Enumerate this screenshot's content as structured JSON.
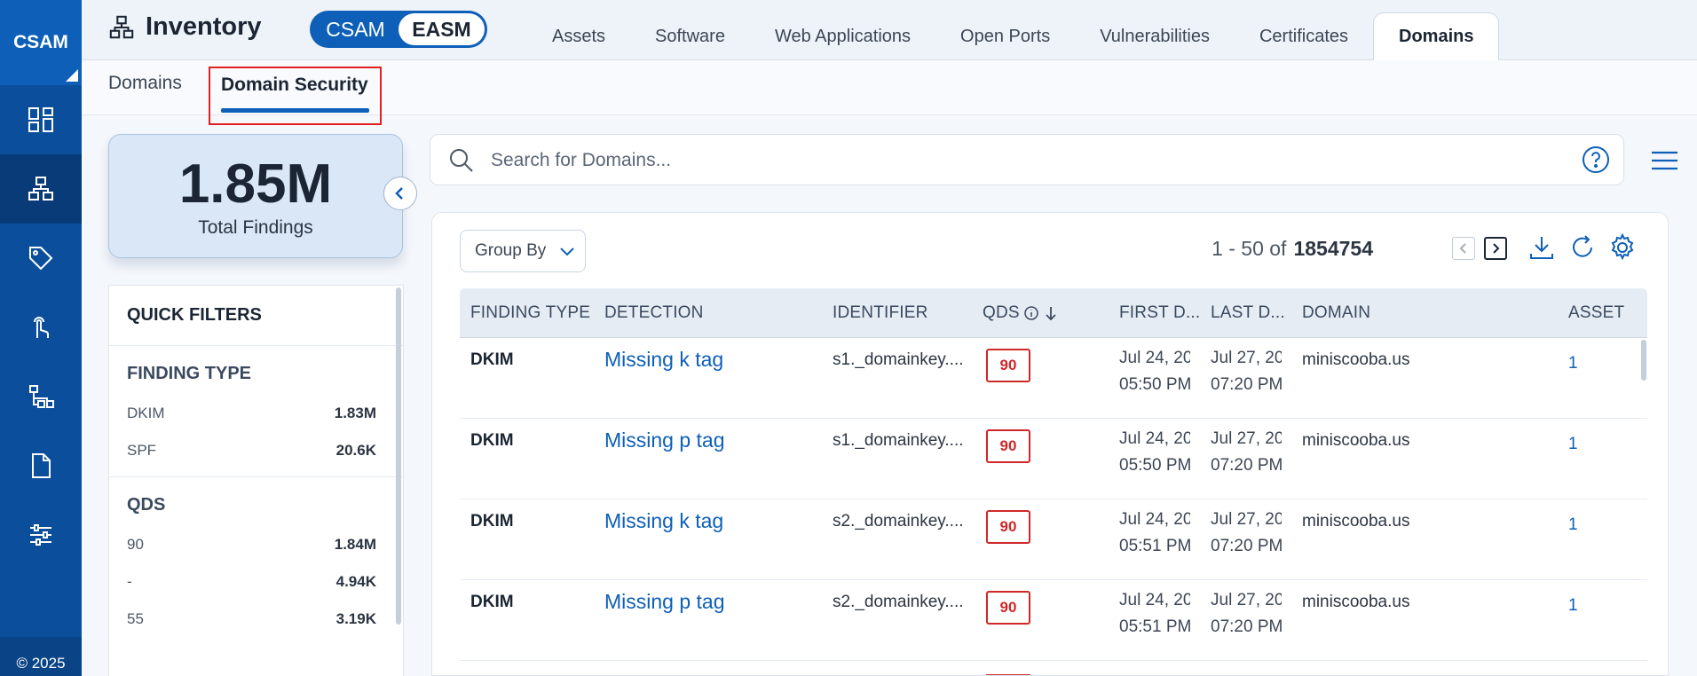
{
  "app": {
    "brand": "CSAM",
    "copyright": "© 2025"
  },
  "header": {
    "title": "Inventory",
    "toggle": [
      "CSAM",
      "EASM"
    ],
    "tabs": [
      "Assets",
      "Software",
      "Web Applications",
      "Open Ports",
      "Vulnerabilities",
      "Certificates",
      "Domains"
    ],
    "active_tab": "Domains"
  },
  "subtabs": {
    "items": [
      "Domains",
      "Domain Security"
    ],
    "active": "Domain Security"
  },
  "summary": {
    "total": "1.85M",
    "label": "Total Findings"
  },
  "quick_filters": {
    "title": "QUICK FILTERS",
    "sections": [
      {
        "title": "FINDING TYPE",
        "rows": [
          {
            "label": "DKIM",
            "count": "1.83M"
          },
          {
            "label": "SPF",
            "count": "20.6K"
          }
        ]
      },
      {
        "title": "QDS",
        "rows": [
          {
            "label": "90",
            "count": "1.84M"
          },
          {
            "label": "-",
            "count": "4.94K"
          },
          {
            "label": "55",
            "count": "3.19K"
          }
        ]
      }
    ]
  },
  "search": {
    "placeholder": "Search for Domains..."
  },
  "results": {
    "group_by": "Group By",
    "range": "1 - 50 of",
    "total": "1854754",
    "columns": [
      "FINDING TYPE",
      "DETECTION",
      "IDENTIFIER",
      "QDS",
      "FIRST D...",
      "LAST D...",
      "DOMAIN",
      "ASSET"
    ],
    "rows": [
      {
        "type": "DKIM",
        "detection": "Missing k tag",
        "identifier": "s1._domainkey....",
        "qds": "90",
        "first_date": "Jul 24, 20",
        "first_time": "05:50 PM",
        "last_date": "Jul 27, 20",
        "last_time": "07:20 PM",
        "domain": "miniscooba.us",
        "asset": "1"
      },
      {
        "type": "DKIM",
        "detection": "Missing p tag",
        "identifier": "s1._domainkey....",
        "qds": "90",
        "first_date": "Jul 24, 20",
        "first_time": "05:50 PM",
        "last_date": "Jul 27, 20",
        "last_time": "07:20 PM",
        "domain": "miniscooba.us",
        "asset": "1"
      },
      {
        "type": "DKIM",
        "detection": "Missing k tag",
        "identifier": "s2._domainkey....",
        "qds": "90",
        "first_date": "Jul 24, 20",
        "first_time": "05:51 PM",
        "last_date": "Jul 27, 20",
        "last_time": "07:20 PM",
        "domain": "miniscooba.us",
        "asset": "1"
      },
      {
        "type": "DKIM",
        "detection": "Missing p tag",
        "identifier": "s2._domainkey....",
        "qds": "90",
        "first_date": "Jul 24, 20",
        "first_time": "05:51 PM",
        "last_date": "Jul 27, 20",
        "last_time": "07:20 PM",
        "domain": "miniscooba.us",
        "asset": "1"
      }
    ]
  },
  "colors": {
    "brand_blue": "#0d5fb8",
    "rail_blue": "#0b4f9c",
    "qds_red": "#d02828",
    "highlight_red": "#e02020"
  }
}
